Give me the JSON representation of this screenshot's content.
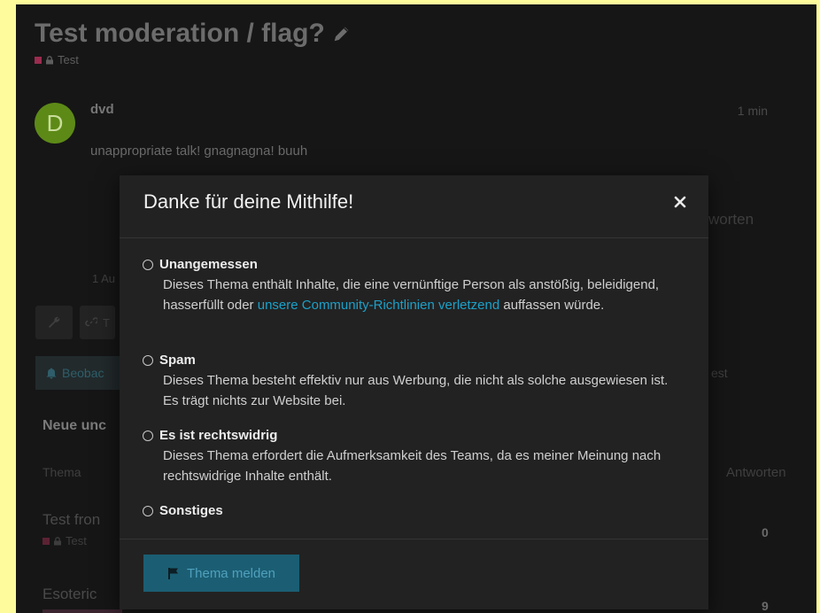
{
  "topic": {
    "title": "Test moderation / flag?",
    "category": "Test"
  },
  "post": {
    "avatar_letter": "D",
    "username": "dvd",
    "time": "1 min",
    "text": "unappropriate talk! gnagnagna! buuh"
  },
  "background": {
    "replies_fragment": "worten",
    "date_fragment": "1 Au",
    "tool2_fragment": "T",
    "watch_fragment": "Beobac",
    "test_fragment": "est",
    "neue_fragment": "Neue unc",
    "col_topic": "Thema",
    "col_replies": "Antworten",
    "row1_title": "Test fron",
    "row1_category": "Test",
    "row1_replies": "0",
    "row2_title": "Esoteric",
    "row2_replies": "9"
  },
  "modal": {
    "title": "Danke für deine Mithilfe!",
    "options": [
      {
        "label": "Unangemessen",
        "desc_before_link": "Dieses Thema enthält Inhalte, die eine vernünftige Person als anstößig, beleidigend, hasserfüllt oder ",
        "link": "unsere Community-Richtlinien verletzend",
        "desc_after_link": " auffassen würde."
      },
      {
        "label": "Spam",
        "desc": "Dieses Thema besteht effektiv nur aus Werbung, die nicht als solche ausgewiesen ist. Es trägt nichts zur Website bei."
      },
      {
        "label": "Es ist rechtswidrig",
        "desc": "Dieses Thema erfordert die Aufmerksamkeit des Teams, da es meiner Meinung nach rechtswidrige Inhalte enthält."
      },
      {
        "label": "Sonstiges"
      }
    ],
    "submit_label": "Thema melden"
  },
  "colors": {
    "accent": "#1ba1c9",
    "category": "#9b2c4f",
    "avatar": "#5d8a17"
  }
}
